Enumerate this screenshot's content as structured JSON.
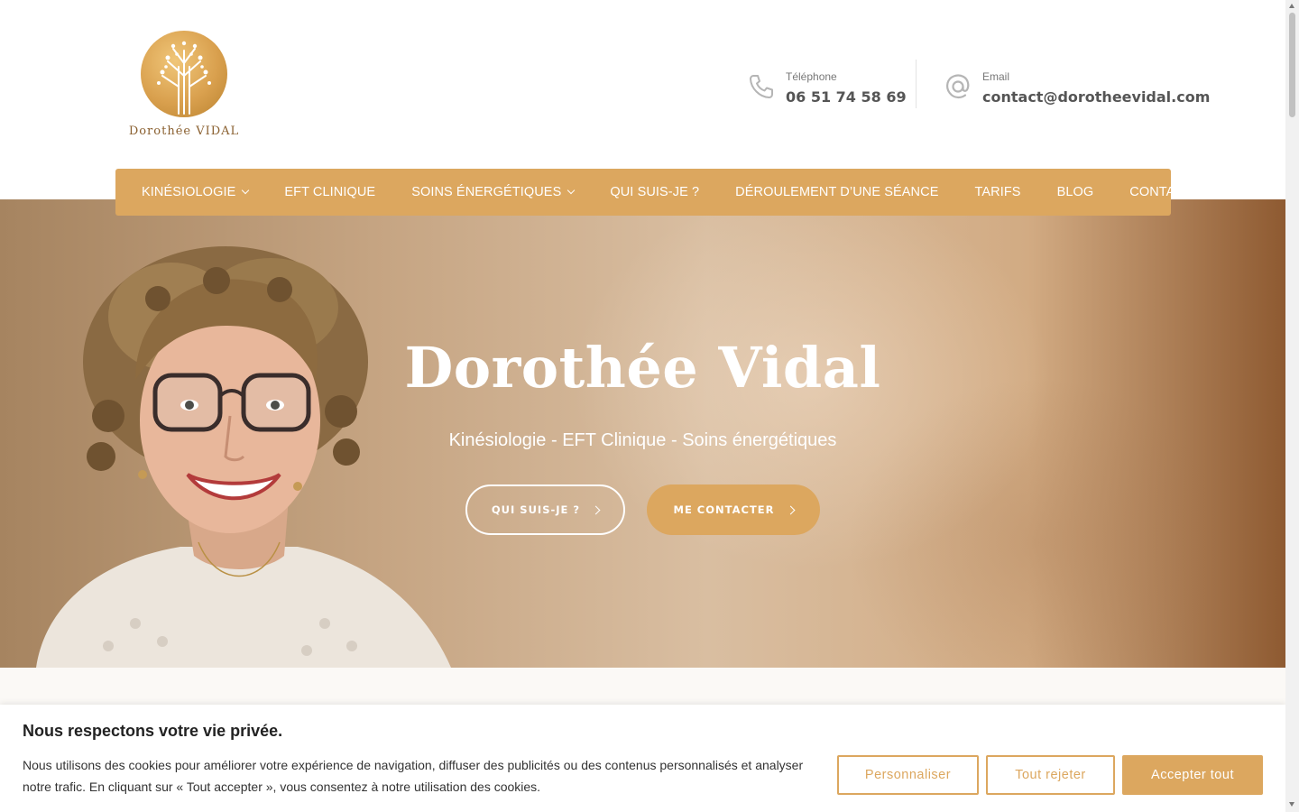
{
  "logo": {
    "text": "Dorothée VIDAL",
    "icon": "tree-logo-icon",
    "color": "#d9a04e"
  },
  "contact": {
    "phone": {
      "label": "Téléphone",
      "value": "06 51 74 58 69",
      "icon": "phone-icon"
    },
    "email": {
      "label": "Email",
      "value": "contact@dorotheevidal.com",
      "icon": "at-icon"
    }
  },
  "nav": {
    "items": [
      {
        "label": "KINÉSIOLOGIE",
        "dropdown": true
      },
      {
        "label": "EFT CLINIQUE",
        "dropdown": false
      },
      {
        "label": "SOINS ÉNERGÉTIQUES",
        "dropdown": true
      },
      {
        "label": "QUI SUIS-JE ?",
        "dropdown": false
      },
      {
        "label": "DÉROULEMENT D’UNE SÉANCE",
        "dropdown": false
      },
      {
        "label": "TARIFS",
        "dropdown": false
      },
      {
        "label": "BLOG",
        "dropdown": false
      },
      {
        "label": "CONTACT",
        "dropdown": false
      }
    ]
  },
  "hero": {
    "title": "Dorothée Vidal",
    "subtitle": "Kinésiologie - EFT Clinique - Soins énergétiques",
    "btn_about": "QUI SUIS-JE ?",
    "btn_contact": "ME CONTACTER"
  },
  "cookie": {
    "title": "Nous respectons votre vie privée.",
    "text": "Nous utilisons des cookies pour améliorer votre expérience de navigation, diffuser des publicités ou des contenus personnalisés et analyser notre trafic. En cliquant sur « Tout accepter », vous consentez à notre utilisation des cookies.",
    "customize": "Personnaliser",
    "reject": "Tout rejeter",
    "accept": "Accepter tout"
  },
  "colors": {
    "accent": "#dca75f",
    "text": "#555555"
  }
}
